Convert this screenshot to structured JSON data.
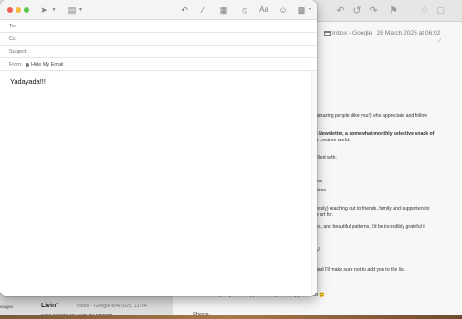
{
  "background": {
    "toolbar_icons": [
      "back-icon",
      "reply-all-icon",
      "forward-icon",
      "flag-icon",
      "bell-icon",
      "search-icon"
    ],
    "message_header": {
      "mailbox": "Inbox - Google",
      "date": "28 March 2025 at 06:02"
    },
    "body_lines": [
      "amazing people (like you!) who appreciate and follow",
      "t Newsletter, a somewhat-monthly selective snack of",
      "y creative world.",
      "filled with:",
      "ers",
      "tions",
      "essly) reaching out to friends, family and supporters to",
      "e art for.",
      "es, and beautiful patterns, I'd be incredibly grateful if",
      "U.",
      "and I'll make sure not to add you to the list."
    ],
    "bottom_lines": [
      "Have a lovely day. Your support is very much appreciated 😊",
      "Cheers,"
    ],
    "message_list_item": {
      "title": "Livin'",
      "meta": "Inbox - Google  8/4/2025, 11:34",
      "subject": "New Access to Livin' by MandyI"
    },
    "sidebar_fragment": "ssages"
  },
  "compose": {
    "toolbar": {
      "send_icon": "send-icon",
      "header_icon": "header-fields-icon",
      "format_label": "Aa"
    },
    "fields": {
      "to_label": "To:",
      "cc_label": "Cc:",
      "subject_label": "Subject:",
      "from_label": "From:",
      "from_value": "Hide My Email"
    },
    "body": {
      "text": "Yadayada!!!"
    }
  },
  "colors": {
    "close": "#ee5e55",
    "minimize": "#f5bd40",
    "zoom": "#5cc64c",
    "cursor": "#c06a00"
  }
}
